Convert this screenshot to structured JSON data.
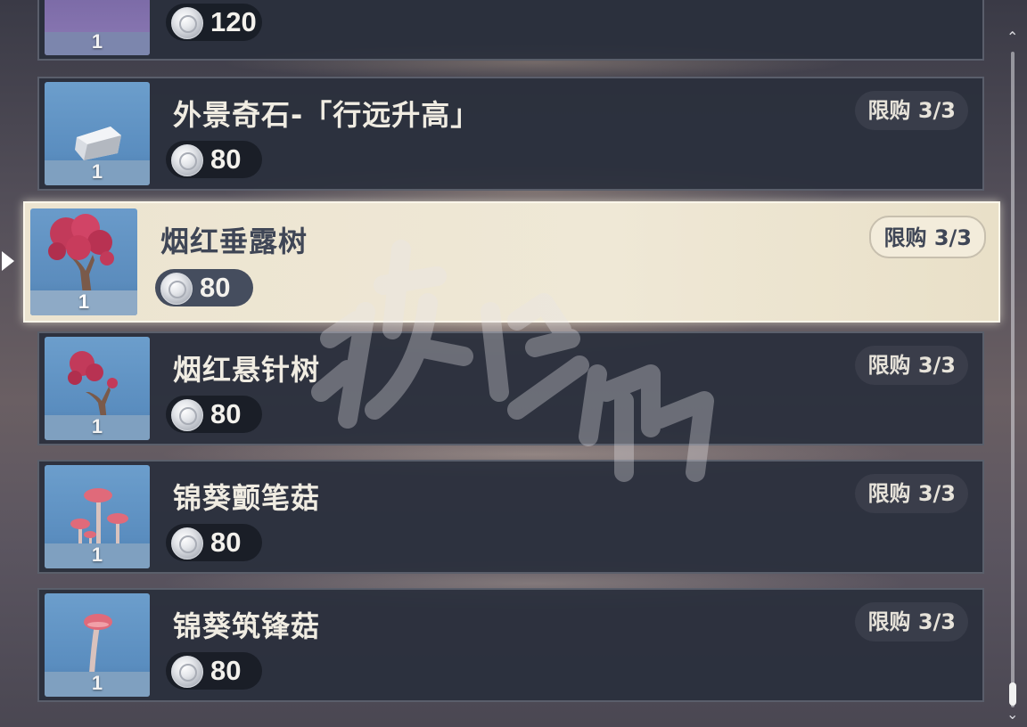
{
  "items": [
    {
      "name": "",
      "price": "120",
      "qty": "1",
      "limit": ""
    },
    {
      "name": "外景奇石-「行远升高」",
      "price": "80",
      "qty": "1",
      "limit": "限购 3/3",
      "icon": "stone-icon"
    },
    {
      "name": "烟红垂露树",
      "price": "80",
      "qty": "1",
      "limit": "限购 3/3",
      "icon": "red-tree-icon",
      "selected": true
    },
    {
      "name": "烟红悬针树",
      "price": "80",
      "qty": "1",
      "limit": "限购 3/3",
      "icon": "red-tree-icon"
    },
    {
      "name": "锦葵颤笔菇",
      "price": "80",
      "qty": "1",
      "limit": "限购 3/3",
      "icon": "mushroom-cluster-icon"
    },
    {
      "name": "锦葵筑锋菇",
      "price": "80",
      "qty": "1",
      "limit": "限购 3/3",
      "icon": "mushroom-icon"
    }
  ],
  "currency_icon": "silver-coin-icon",
  "colors": {
    "selected_bg": "#efe8d6",
    "row_bg": "#2a2f3c",
    "thumb_bg": "#5a8dbf"
  }
}
